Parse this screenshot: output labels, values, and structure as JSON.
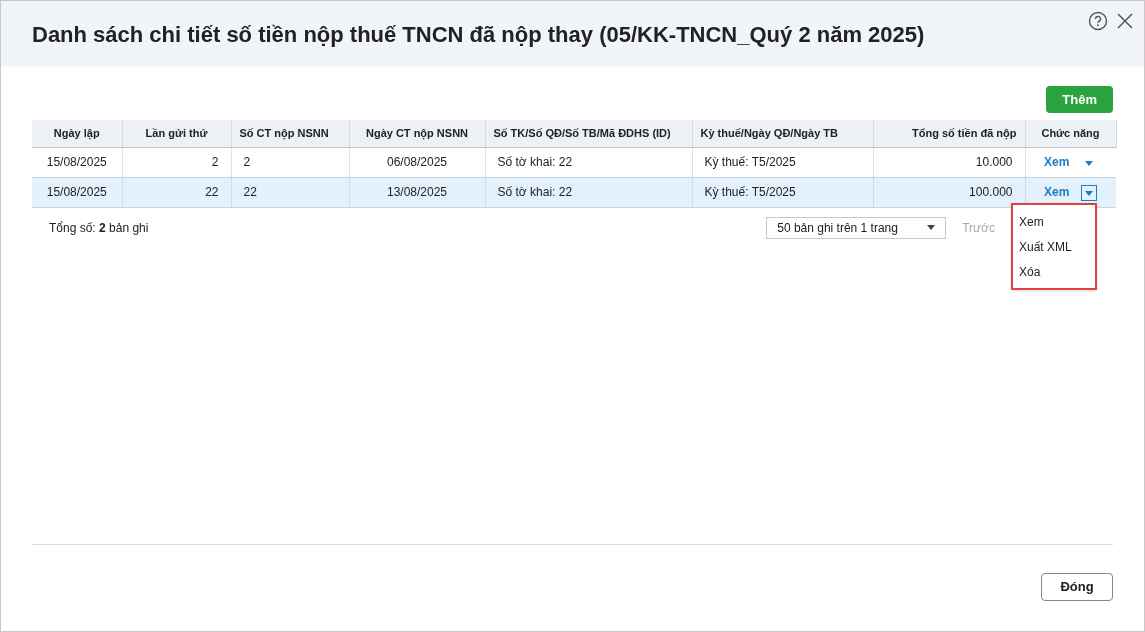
{
  "window": {
    "title": "Danh sách chi tiết số tiền nộp thuế TNCN đã nộp thay (05/KK-TNCN_Quý 2 năm 2025)"
  },
  "add_button": "Thêm",
  "table": {
    "columns": [
      "Ngày lập",
      "Lần gửi thứ",
      "Số CT nộp NSNN",
      "Ngày CT nộp NSNN",
      "Số TK/Số QĐ/Số TB/Mã ĐDHS (ID)",
      "Kỳ thuế/Ngày QĐ/Ngày TB",
      "Tổng số tiền đã nộp",
      "Chức năng"
    ],
    "rows": [
      {
        "selected": false,
        "menu_open": false,
        "cells": [
          "15/08/2025",
          "2",
          "2",
          "06/08/2025",
          "Số tờ khai: 22",
          "Kỳ thuế: T5/2025",
          "10.000"
        ],
        "action": "Xem"
      },
      {
        "selected": true,
        "menu_open": true,
        "cells": [
          "15/08/2025",
          "22",
          "22",
          "13/08/2025",
          "Số tờ khai: 22",
          "Kỳ thuế: T5/2025",
          "100.000"
        ],
        "action": "Xem"
      }
    ]
  },
  "action_menu": [
    "Xem",
    "Xuất XML",
    "Xóa"
  ],
  "footer": {
    "total": "Tổng số: **2** bản ghi",
    "page_size": "50 bản ghi trên 1 trang",
    "prev": "Trước",
    "prev_disabled": true
  },
  "close_button": "Đóng"
}
